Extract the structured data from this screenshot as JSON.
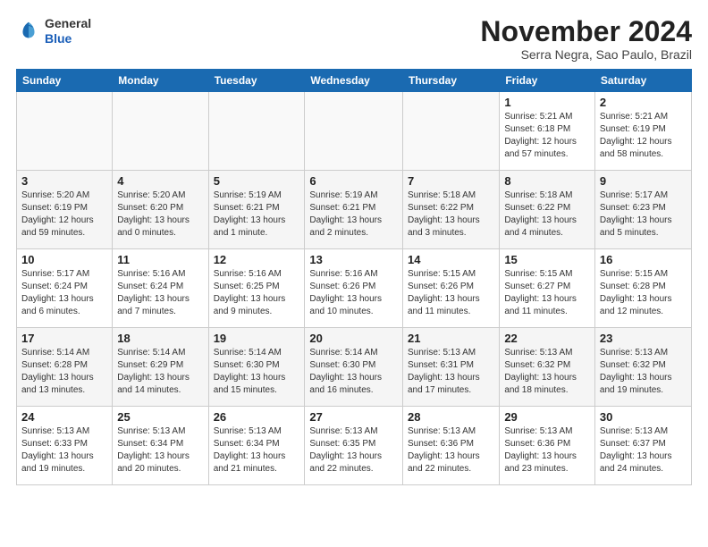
{
  "logo": {
    "general": "General",
    "blue": "Blue"
  },
  "title": "November 2024",
  "location": "Serra Negra, Sao Paulo, Brazil",
  "weekdays": [
    "Sunday",
    "Monday",
    "Tuesday",
    "Wednesday",
    "Thursday",
    "Friday",
    "Saturday"
  ],
  "weeks": [
    [
      {
        "day": "",
        "info": ""
      },
      {
        "day": "",
        "info": ""
      },
      {
        "day": "",
        "info": ""
      },
      {
        "day": "",
        "info": ""
      },
      {
        "day": "",
        "info": ""
      },
      {
        "day": "1",
        "info": "Sunrise: 5:21 AM\nSunset: 6:18 PM\nDaylight: 12 hours\nand 57 minutes."
      },
      {
        "day": "2",
        "info": "Sunrise: 5:21 AM\nSunset: 6:19 PM\nDaylight: 12 hours\nand 58 minutes."
      }
    ],
    [
      {
        "day": "3",
        "info": "Sunrise: 5:20 AM\nSunset: 6:19 PM\nDaylight: 12 hours\nand 59 minutes."
      },
      {
        "day": "4",
        "info": "Sunrise: 5:20 AM\nSunset: 6:20 PM\nDaylight: 13 hours\nand 0 minutes."
      },
      {
        "day": "5",
        "info": "Sunrise: 5:19 AM\nSunset: 6:21 PM\nDaylight: 13 hours\nand 1 minute."
      },
      {
        "day": "6",
        "info": "Sunrise: 5:19 AM\nSunset: 6:21 PM\nDaylight: 13 hours\nand 2 minutes."
      },
      {
        "day": "7",
        "info": "Sunrise: 5:18 AM\nSunset: 6:22 PM\nDaylight: 13 hours\nand 3 minutes."
      },
      {
        "day": "8",
        "info": "Sunrise: 5:18 AM\nSunset: 6:22 PM\nDaylight: 13 hours\nand 4 minutes."
      },
      {
        "day": "9",
        "info": "Sunrise: 5:17 AM\nSunset: 6:23 PM\nDaylight: 13 hours\nand 5 minutes."
      }
    ],
    [
      {
        "day": "10",
        "info": "Sunrise: 5:17 AM\nSunset: 6:24 PM\nDaylight: 13 hours\nand 6 minutes."
      },
      {
        "day": "11",
        "info": "Sunrise: 5:16 AM\nSunset: 6:24 PM\nDaylight: 13 hours\nand 7 minutes."
      },
      {
        "day": "12",
        "info": "Sunrise: 5:16 AM\nSunset: 6:25 PM\nDaylight: 13 hours\nand 9 minutes."
      },
      {
        "day": "13",
        "info": "Sunrise: 5:16 AM\nSunset: 6:26 PM\nDaylight: 13 hours\nand 10 minutes."
      },
      {
        "day": "14",
        "info": "Sunrise: 5:15 AM\nSunset: 6:26 PM\nDaylight: 13 hours\nand 11 minutes."
      },
      {
        "day": "15",
        "info": "Sunrise: 5:15 AM\nSunset: 6:27 PM\nDaylight: 13 hours\nand 11 minutes."
      },
      {
        "day": "16",
        "info": "Sunrise: 5:15 AM\nSunset: 6:28 PM\nDaylight: 13 hours\nand 12 minutes."
      }
    ],
    [
      {
        "day": "17",
        "info": "Sunrise: 5:14 AM\nSunset: 6:28 PM\nDaylight: 13 hours\nand 13 minutes."
      },
      {
        "day": "18",
        "info": "Sunrise: 5:14 AM\nSunset: 6:29 PM\nDaylight: 13 hours\nand 14 minutes."
      },
      {
        "day": "19",
        "info": "Sunrise: 5:14 AM\nSunset: 6:30 PM\nDaylight: 13 hours\nand 15 minutes."
      },
      {
        "day": "20",
        "info": "Sunrise: 5:14 AM\nSunset: 6:30 PM\nDaylight: 13 hours\nand 16 minutes."
      },
      {
        "day": "21",
        "info": "Sunrise: 5:13 AM\nSunset: 6:31 PM\nDaylight: 13 hours\nand 17 minutes."
      },
      {
        "day": "22",
        "info": "Sunrise: 5:13 AM\nSunset: 6:32 PM\nDaylight: 13 hours\nand 18 minutes."
      },
      {
        "day": "23",
        "info": "Sunrise: 5:13 AM\nSunset: 6:32 PM\nDaylight: 13 hours\nand 19 minutes."
      }
    ],
    [
      {
        "day": "24",
        "info": "Sunrise: 5:13 AM\nSunset: 6:33 PM\nDaylight: 13 hours\nand 19 minutes."
      },
      {
        "day": "25",
        "info": "Sunrise: 5:13 AM\nSunset: 6:34 PM\nDaylight: 13 hours\nand 20 minutes."
      },
      {
        "day": "26",
        "info": "Sunrise: 5:13 AM\nSunset: 6:34 PM\nDaylight: 13 hours\nand 21 minutes."
      },
      {
        "day": "27",
        "info": "Sunrise: 5:13 AM\nSunset: 6:35 PM\nDaylight: 13 hours\nand 22 minutes."
      },
      {
        "day": "28",
        "info": "Sunrise: 5:13 AM\nSunset: 6:36 PM\nDaylight: 13 hours\nand 22 minutes."
      },
      {
        "day": "29",
        "info": "Sunrise: 5:13 AM\nSunset: 6:36 PM\nDaylight: 13 hours\nand 23 minutes."
      },
      {
        "day": "30",
        "info": "Sunrise: 5:13 AM\nSunset: 6:37 PM\nDaylight: 13 hours\nand 24 minutes."
      }
    ]
  ]
}
